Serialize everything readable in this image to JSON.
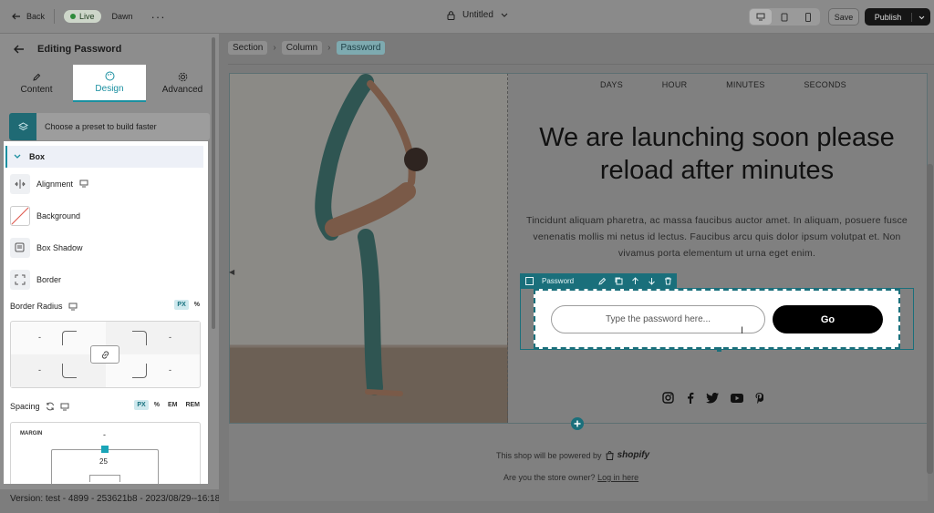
{
  "topbar": {
    "back_label": "Back",
    "live_label": "Live",
    "theme_name": "Dawn",
    "more": "···",
    "page_title": "Untitled",
    "save_label": "Save",
    "publish_label": "Publish"
  },
  "left_panel": {
    "title": "Editing Password",
    "tabs": [
      {
        "label": "Content",
        "icon": "pencil-icon"
      },
      {
        "label": "Design",
        "icon": "palette-icon"
      },
      {
        "label": "Advanced",
        "icon": "gear-icon"
      }
    ],
    "active_tab": "Design",
    "preset_label": "Choose a preset to build faster",
    "box_label": "Box",
    "properties": [
      {
        "label": "Alignment",
        "icon": "alignment-icon"
      },
      {
        "label": "Background",
        "icon": "background-icon"
      },
      {
        "label": "Box Shadow",
        "icon": "box-shadow-icon"
      },
      {
        "label": "Border",
        "icon": "border-icon"
      }
    ],
    "border_radius": {
      "label": "Border Radius",
      "units": [
        "PX",
        "%"
      ],
      "active_unit": "PX",
      "values": [
        "-",
        "-",
        "-",
        "-"
      ]
    },
    "spacing": {
      "label": "Spacing",
      "units": [
        "PX",
        "%",
        "EM",
        "REM"
      ],
      "active_unit": "PX",
      "margin_label": "MARGIN",
      "margin_top": "-",
      "padding_value": "25"
    }
  },
  "version": "Version: test - 4899 - 253621b8 - 2023/08/29--16:18",
  "breadcrumb": [
    "Section",
    "Column",
    "Password"
  ],
  "page": {
    "countdown": [
      "DAYS",
      "HOUR",
      "MINUTES",
      "SECONDS"
    ],
    "headline": "We are launching soon please reload after minutes",
    "paragraph": "Tincidunt aliquam pharetra, ac massa faucibus auctor amet. In aliquam, posuere fusce venenatis mollis mi netus id lectus. Faucibus arcu quis dolor ipsum volutpat et. Non vivamus porta elementum ut urna eget enim.",
    "element_label": "Password",
    "password_placeholder": "Type the password here...",
    "go_label": "Go",
    "socials": [
      "instagram-icon",
      "facebook-icon",
      "twitter-icon",
      "youtube-icon",
      "pinterest-icon"
    ],
    "powered_text": "This shop will be powered by",
    "powered_brand": "shopify",
    "owner_text": "Are you the store owner?",
    "owner_link": "Log in here"
  },
  "colors": {
    "accent": "#1a8fa0",
    "selection": "#1a6f7b",
    "button": "#000000"
  }
}
